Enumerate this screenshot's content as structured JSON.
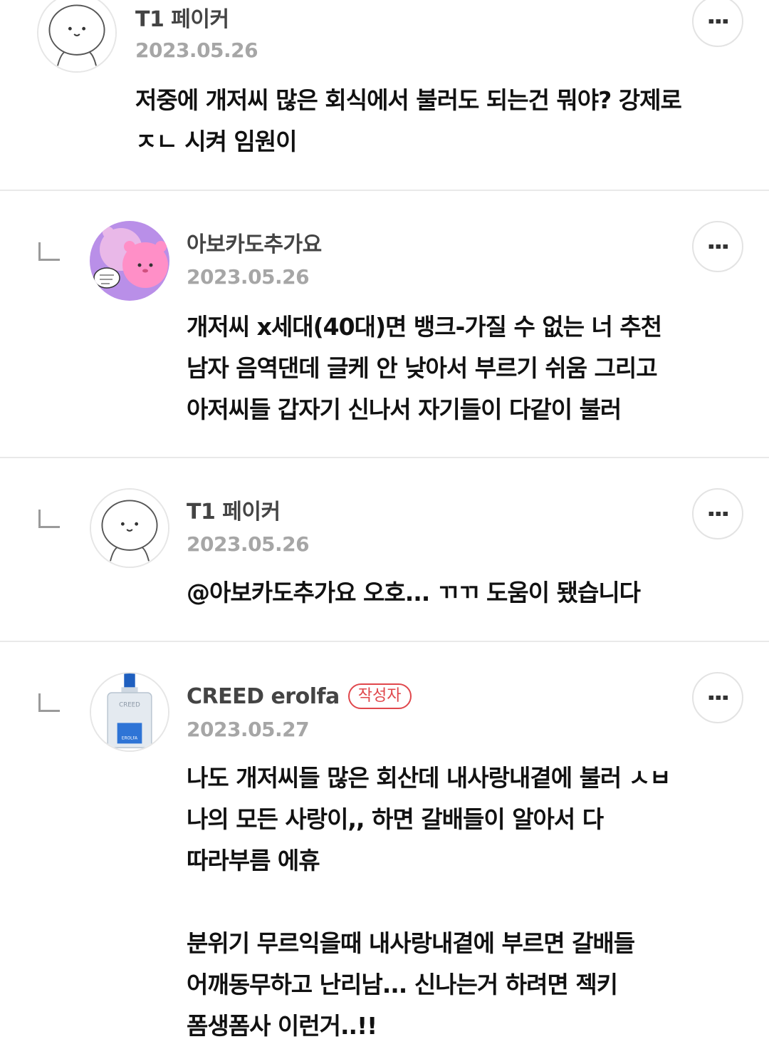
{
  "comments": [
    {
      "author": "T1 페이커",
      "date": "2023.05.26",
      "text": "저중에 개저씨 많은 회식에서 불러도 되는건 뭐야? 강제로\nㅈㄴ 시켜 임원이",
      "avatar_icon": "seal-avatar-icon"
    },
    {
      "author": "아보카도추가요",
      "date": "2023.05.26",
      "text": "개저씨 x세대(40대)면 뱅크-가질 수 없는 너 추천\n남자 음역댄데 글케 안 낮아서 부르기 쉬움 그리고\n아저씨들 갑자기 신나서 자기들이 다같이 불러",
      "avatar_icon": "pink-bear-avatar-icon"
    },
    {
      "author": "T1 페이커",
      "date": "2023.05.26",
      "text": "@아보카도추가요  오호... ㄲㄲ 도움이 됐습니다",
      "avatar_icon": "seal-avatar-icon"
    },
    {
      "author": "CREED erolfa",
      "badge": "작성자",
      "date": "2023.05.27",
      "text": "나도 개저씨들 많은 회산데 내사랑내곁에 불러 ㅅㅂ\n나의 모든 사랑이,, 하면 갈배들이 알아서 다\n따라부름 에휴\n\n분위기 무르익을때 내사랑내곁에 부르면 갈배들\n어깨동무하고 난리남... 신나는거 하려면 젝키\n폼생폼사 이런거..!!",
      "avatar_icon": "perfume-bottle-avatar-icon"
    }
  ],
  "more_icon": "⋮",
  "colors": {
    "badge": "#e0474c",
    "date": "#a6a6a6",
    "divider": "#e9e9e9"
  }
}
